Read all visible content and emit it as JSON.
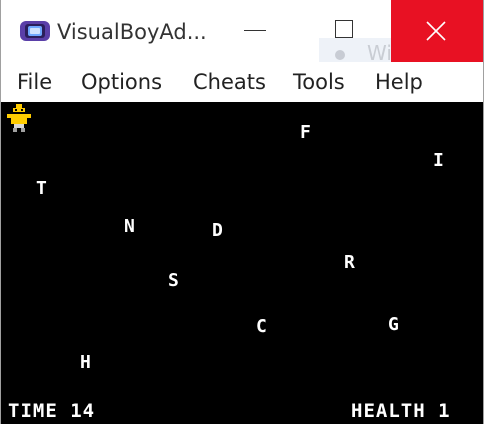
{
  "window": {
    "title": "VisualBoyAd...",
    "background_window_text": "Window S"
  },
  "menu": {
    "items": [
      "File",
      "Options",
      "Cheats",
      "Tools",
      "Help"
    ]
  },
  "game": {
    "letters": [
      "F",
      "I",
      "T",
      "N",
      "D",
      "R",
      "S",
      "C",
      "G",
      "H"
    ],
    "hud": {
      "time_label": "TIME",
      "time_value": "14",
      "health_label": "HEALTH",
      "health_value": "1"
    }
  },
  "colors": {
    "close_button": "#e81123",
    "screen_background": "#000000",
    "text_on_screen": "#ffffff",
    "player": "#ffcc00"
  },
  "icons": {
    "app": "gameboy-icon",
    "minimize": "minimize-icon",
    "maximize": "maximize-icon",
    "close": "close-icon",
    "player": "player-sprite-icon"
  }
}
